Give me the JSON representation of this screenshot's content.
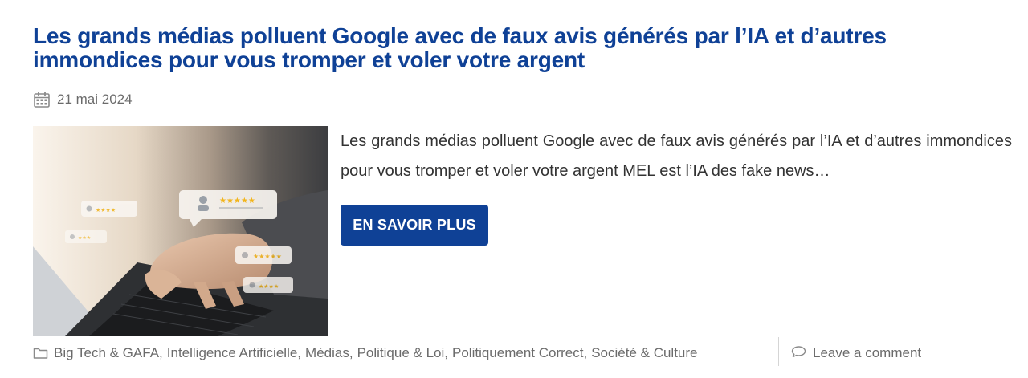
{
  "post": {
    "title": "Les grands médias polluent Google avec de faux avis générés par l’IA et d’autres immondices pour vous tromper et voler votre argent",
    "date": "21 mai 2024",
    "excerpt": "Les grands médias polluent Google avec de faux avis générés par l’IA et d’autres immondices pour vous tromper et voler votre argent MEL est l’IA des fake news…",
    "read_more_label": "EN SAVOIR PLUS",
    "image_alt": "Mains tapant sur un ordinateur portable avec des bulles d’avis étoilés",
    "thumbnail_ratings": [
      "★★★★★",
      "★★★★",
      "★★★★★",
      "★★★★",
      "★★★"
    ]
  },
  "meta": {
    "categories": [
      "Big Tech & GAFA",
      "Intelligence Artificielle",
      "Médias",
      "Politique & Loi",
      "Politiquement Correct",
      "Société & Culture"
    ],
    "separator": ",",
    "comments_label": "Leave a comment"
  },
  "icons": {
    "date": "calendar-icon",
    "categories": "folder-icon",
    "comments": "comment-bubble-icon"
  },
  "colors": {
    "title": "#0f4196",
    "button_bg": "#0f4196",
    "button_text": "#ffffff",
    "meta_text": "#6b6b6b",
    "body_text": "#333333",
    "star": "#f2b51c"
  }
}
